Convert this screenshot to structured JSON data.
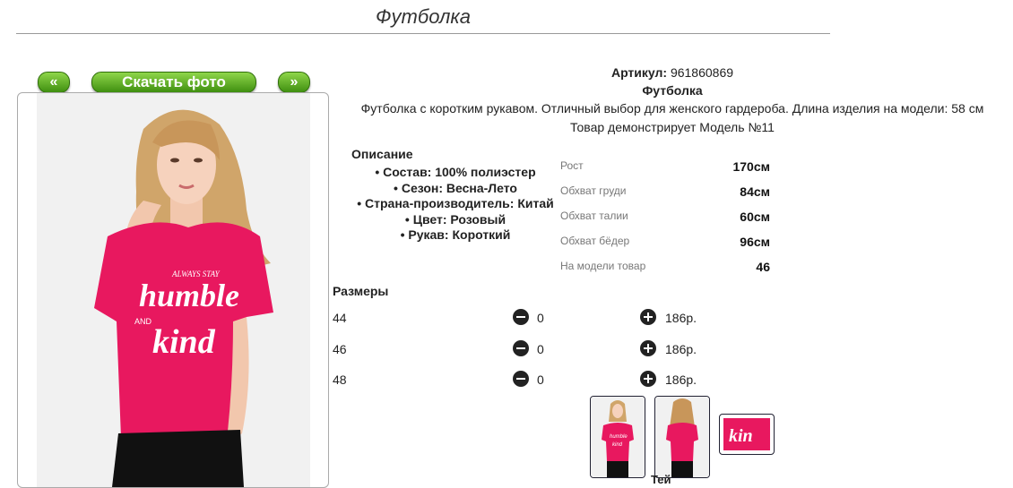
{
  "page": {
    "title": "Футболка"
  },
  "gallery": {
    "prev_label": "«",
    "download_label": "Скачать фото",
    "next_label": "»"
  },
  "product": {
    "article_label": "Артикул:",
    "article_value": "961860869",
    "name": "Футболка",
    "summary": "Футболка с коротким рукавом. Отличный выбор для женского гардероба. Длина изделия на модели: 58 см",
    "model_text": "Товар демонстрирует Модель №11",
    "print_text": [
      "ALWAYS STAY",
      "humble",
      "AND",
      "kind"
    ]
  },
  "description": {
    "title": "Описание",
    "items": [
      "Состав: 100% полиэстер",
      "Сезон: Весна-Лето",
      "Страна-производитель: Китай",
      "Цвет: Розовый",
      "Рукав: Короткий"
    ]
  },
  "measurements": [
    {
      "label": "Рост",
      "value": "170см"
    },
    {
      "label": "Обхват груди",
      "value": "84см"
    },
    {
      "label": "Обхват талии",
      "value": "60см"
    },
    {
      "label": "Обхват бёдер",
      "value": "96см"
    },
    {
      "label": "На модели товар",
      "value": "46"
    }
  ],
  "sizes": {
    "title": "Размеры",
    "rows": [
      {
        "size": "44",
        "qty": "0",
        "price": "186р."
      },
      {
        "size": "46",
        "qty": "0",
        "price": "186р."
      },
      {
        "size": "48",
        "qty": "0",
        "price": "186р."
      }
    ]
  },
  "thumbnails": {
    "detail_text": "kin",
    "print_mini": [
      "humble",
      "kind"
    ],
    "cut_text": "Тей"
  },
  "colors": {
    "tshirt": "#e8185f",
    "button_green": "#5fb52a",
    "pants": "#111111",
    "hair": "#d0a56a"
  }
}
